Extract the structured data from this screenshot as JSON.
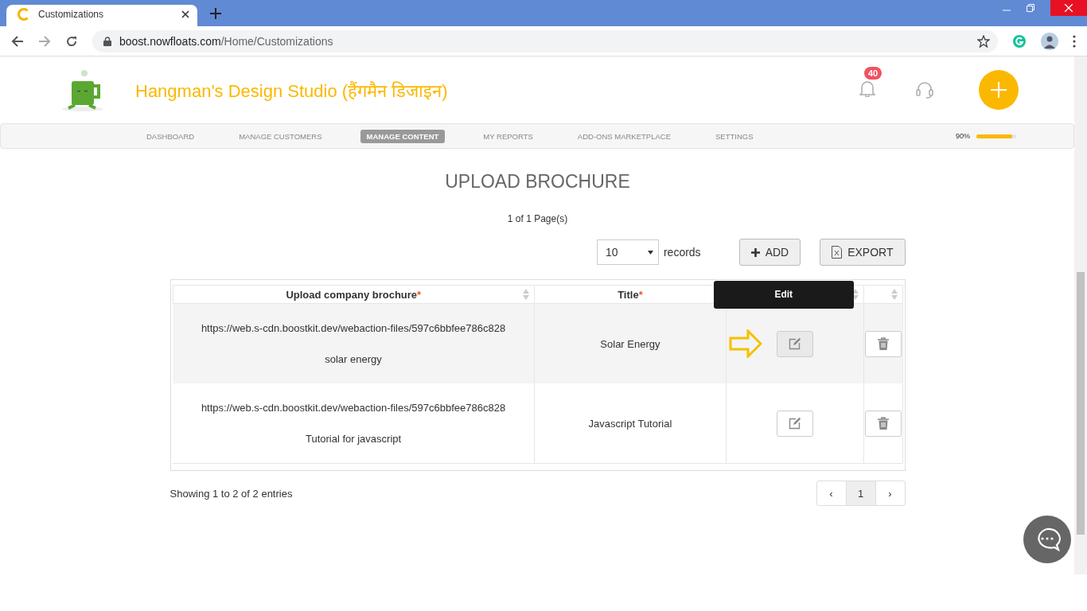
{
  "browser": {
    "tab_title": "Customizations",
    "url_host": "boost.nowfloats.com",
    "url_path": "/Home/Customizations"
  },
  "header": {
    "brand": "Hangman's Design Studio (हैंगमैन डिजाइन)",
    "notification_count": "40"
  },
  "nav": {
    "items": [
      {
        "label": "DASHBOARD",
        "selected": false
      },
      {
        "label": "MANAGE CUSTOMERS",
        "selected": false
      },
      {
        "label": "MANAGE CONTENT",
        "selected": true
      },
      {
        "label": "MY REPORTS",
        "selected": false
      },
      {
        "label": "ADD-ONS MARKETPLACE",
        "selected": false
      },
      {
        "label": "SETTINGS",
        "selected": false
      }
    ],
    "progress": {
      "reading": "90%",
      "level": 0.9
    }
  },
  "page_title": "UPLOAD BROCHURE",
  "page_info": "1 of 1 Page(s)",
  "toolbar": {
    "page_size": "10",
    "page_size_label": "records",
    "add_button": "ADD",
    "export_button": "EXPORT"
  },
  "table": {
    "columns": [
      {
        "label": "Upload company brochure",
        "required_mark": "*"
      },
      {
        "label": "Title",
        "required_mark": "*"
      },
      {},
      {}
    ],
    "tooltip": "Edit",
    "rows": [
      {
        "url": "https://web.s-cdn.boostkit.dev/webaction-files/597c6bbfee786c828",
        "description": "solar energy",
        "title": "Solar Energy",
        "hovered": true
      },
      {
        "url": "https://web.s-cdn.boostkit.dev/webaction-files/597c6bbfee786c828",
        "description": "Tutorial for javascript",
        "title": "Javascript Tutorial",
        "hovered": false
      }
    ]
  },
  "footer": {
    "info": "Showing 1 to 2 of 2 entries",
    "prev": "‹",
    "next": "›",
    "pages": [
      {
        "label": "1",
        "selected": true
      }
    ]
  }
}
